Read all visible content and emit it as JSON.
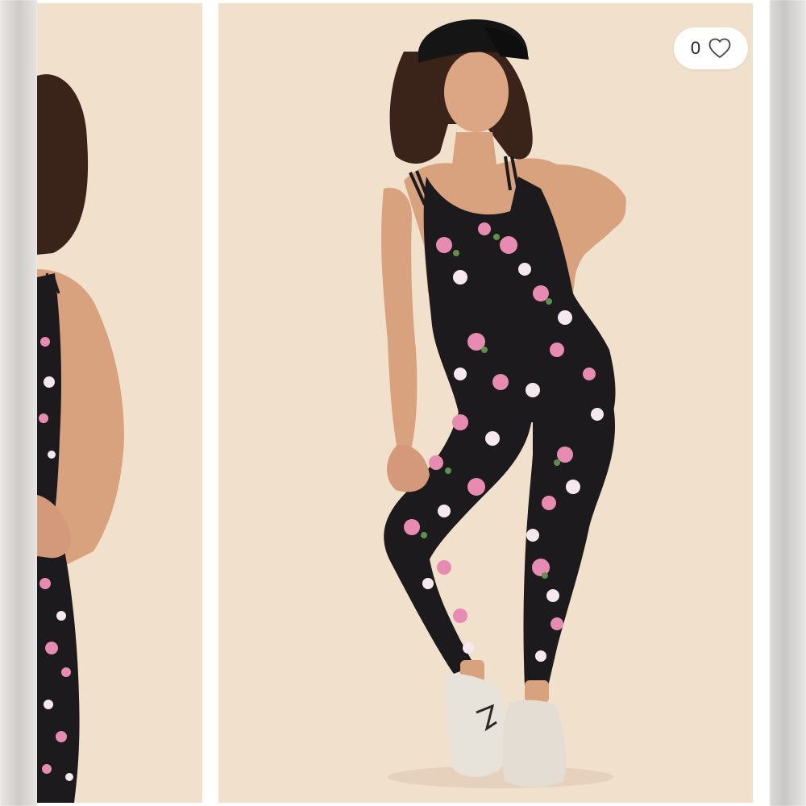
{
  "listing": {
    "like_count": "0",
    "colors": {
      "backdrop": "#f1e0cc",
      "garment": "#1c1a1c",
      "floral_pink": "#e88bb3",
      "floral_white": "#f6e9ee",
      "leaf_green": "#5f8e4e",
      "skin": "#d9a27e",
      "hair": "#3a2318",
      "cap": "#151515",
      "sneakers": "#e7e2da"
    }
  },
  "icons": {
    "like": "heart-outline-icon"
  }
}
